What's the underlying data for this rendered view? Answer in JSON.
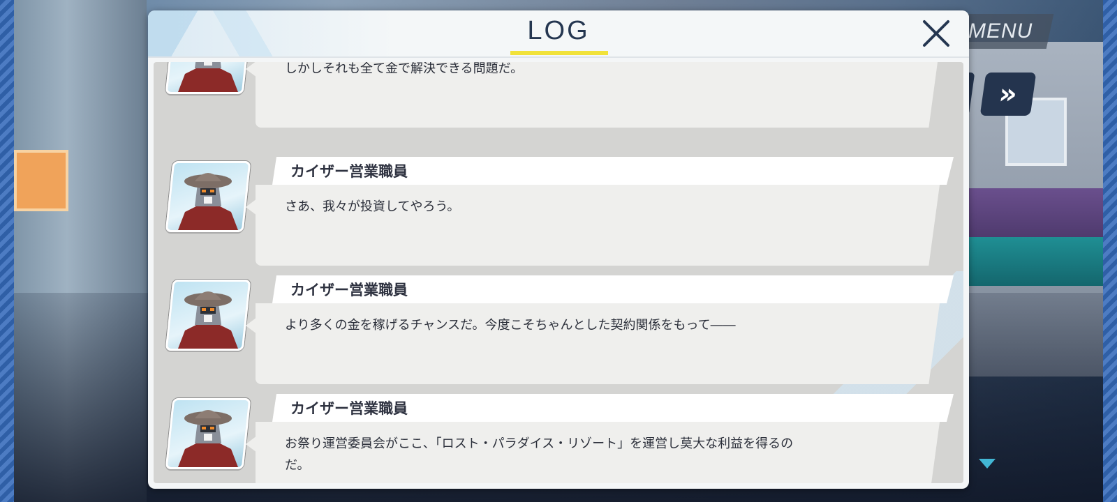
{
  "menu": {
    "label": "MENU"
  },
  "fast_forward": {
    "icon": "double-chevron-right-icon",
    "glyph": "»"
  },
  "log": {
    "title": "LOG",
    "close_icon": "close-icon",
    "entries": [
      {
        "speaker": "",
        "text": "しかしそれも全て金で解決できる問題だ。",
        "continuation": ""
      },
      {
        "speaker": "カイザー営業職員",
        "text": "さあ、我々が投資してやろう。",
        "continuation": ""
      },
      {
        "speaker": "カイザー営業職員",
        "text": "より多くの金を稼げるチャンスだ。今度こそちゃんとした契約関係をもって――",
        "continuation": ""
      },
      {
        "speaker": "カイザー営業職員",
        "text": "お祭り運営委員会がここ、「ロスト・パラダイス・リゾート」を運営し莫大な利益を得るの",
        "continuation": "だ。"
      }
    ]
  },
  "colors": {
    "title_underline": "#f1e23a",
    "title_text": "#243650",
    "panel_bg": "#f4f6f7",
    "bubble_bg": "#efefed",
    "scroll_indicator": "#42b6d4"
  }
}
